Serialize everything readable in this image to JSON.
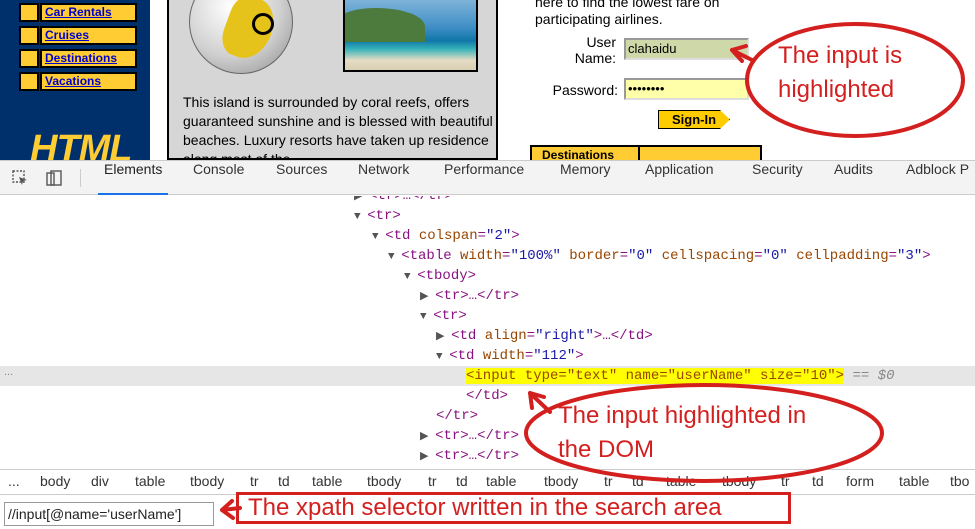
{
  "webpage": {
    "nav_links": [
      "Car Rentals",
      "Cruises",
      "Destinations",
      "Vacations"
    ],
    "logo_text": "HTML",
    "island_text": "This island is surrounded by coral reefs, offers guaranteed sunshine and is blessed with beautiful beaches. Luxury resorts have taken up residence along most of the",
    "login": {
      "intro_line1": "here to find the lowest fare on",
      "intro_line2": "participating airlines.",
      "user_label_1": "User",
      "user_label_2": "Name:",
      "user_value": "clahaidu",
      "password_label": "Password:",
      "password_value": "••••••••",
      "signin_label": "Sign-In",
      "destinations_label": "Destinations"
    }
  },
  "devtools": {
    "tabs": [
      "Elements",
      "Console",
      "Sources",
      "Network",
      "Performance",
      "Memory",
      "Application",
      "Security",
      "Audits",
      "Adblock P"
    ],
    "active_tab": "Elements",
    "dom": {
      "l0_pre": "<tr>…</tr>",
      "tr": "tr",
      "td": "td",
      "colspan_name": "colspan",
      "colspan_val": "\"2\"",
      "table": "table",
      "width_name": "width",
      "width_val": "\"100%\"",
      "border_name": "border",
      "border_val": "\"0\"",
      "cellspacing_name": "cellspacing",
      "cellspacing_val": "\"0\"",
      "cellpadding_name": "cellpadding",
      "cellpadding_val": "\"3\"",
      "tbody": "tbody",
      "collapsed_tr": "<tr>…</tr>",
      "align_name": "align",
      "align_val": "\"right\"",
      "collapsed_td_tail": ">…</td>",
      "td_width_val": "\"112\"",
      "input_code": "<input type=\"text\" name=\"userName\" size=\"10\">",
      "eq0": "== $0",
      "close_td": "</td>",
      "close_tr": "</tr>",
      "gutter": "..."
    },
    "breadcrumbs": [
      "...",
      "body",
      "div",
      "table",
      "tbody",
      "tr",
      "td",
      "table",
      "tbody",
      "tr",
      "td",
      "table",
      "tbody",
      "tr",
      "td",
      "table",
      "tbody",
      "tr",
      "td",
      "form",
      "table",
      "tbo"
    ],
    "search_value": "//input[@name='userName']"
  },
  "annotations": {
    "input_highlighted_1": "The input is",
    "input_highlighted_2": "highlighted",
    "dom_highlight_1": "The input highlighted in",
    "dom_highlight_2": "the DOM",
    "xpath_note": "The xpath selector written in the search area"
  },
  "colors": {
    "annotation_red": "#d41f1f",
    "nav_yellow": "#ffcc33",
    "nav_blue": "#00306b",
    "devtools_active": "#1a73e8",
    "dom_highlight": "#ffff00"
  }
}
